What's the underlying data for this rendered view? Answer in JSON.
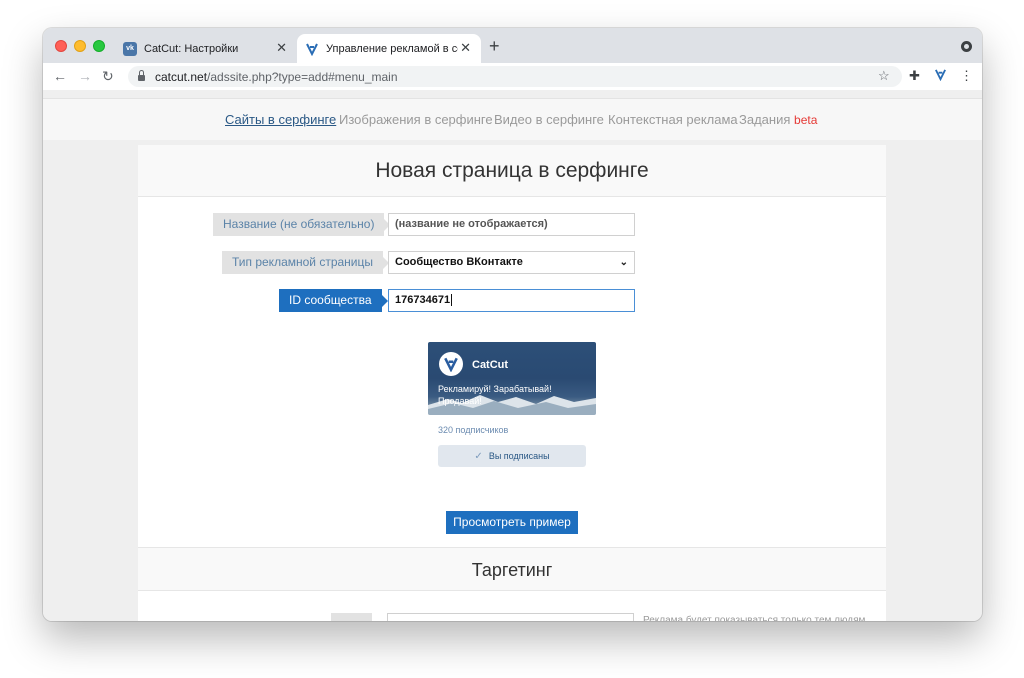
{
  "browser": {
    "tabs": [
      {
        "label": "CatCut: Настройки",
        "favicon": "vk-icon",
        "active": false
      },
      {
        "label": "Управление рекламой в серфинге",
        "favicon": "catcut-icon",
        "active": true
      }
    ],
    "new_tab": "+",
    "url_host": "catcut.net",
    "url_path": "/adssite.php?type=add#menu_main"
  },
  "nav": {
    "items": [
      "Сайты в серфинге",
      "Изображения в серфинге",
      "Видео в серфинге",
      "Контекстная реклама",
      "Задания"
    ],
    "beta": "beta"
  },
  "form": {
    "title": "Новая страница в серфинге",
    "name_label": "Название (не обязательно)",
    "name_value": "(название не отображается)",
    "type_label": "Тип рекламной страницы",
    "type_value": "Сообщество ВКонтакте",
    "id_label": "ID сообщества",
    "id_value": "176734671"
  },
  "preview": {
    "group_name": "CatCut",
    "description": "Рекламируй! Зарабатывай! Продавай!",
    "subscribers": "320 подписчиков",
    "subscribed": "Вы подписаны",
    "button": "Просмотреть пример"
  },
  "targeting": {
    "title": "Таргетинг",
    "note": "Реклама будет показываться только тем людям"
  },
  "colors": {
    "accent": "#1e6fbf",
    "link": "#2a5885",
    "beta": "#e53935"
  }
}
